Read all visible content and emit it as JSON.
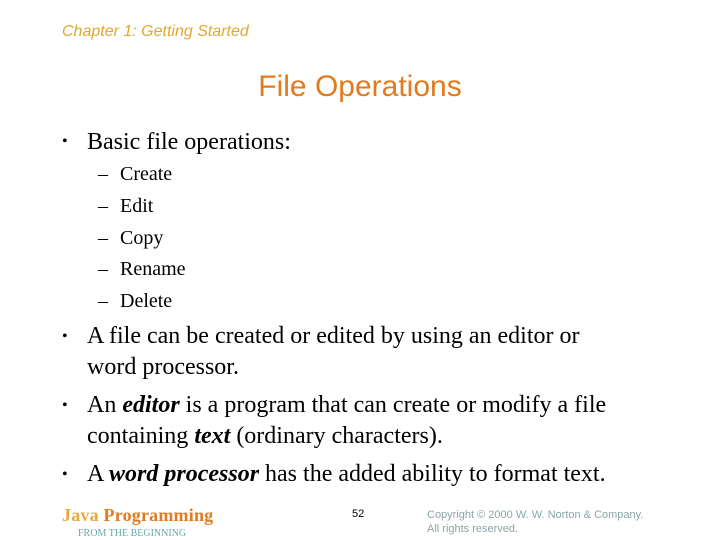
{
  "header": {
    "chapter": "Chapter 1: Getting Started"
  },
  "slide": {
    "title": "File Operations",
    "bullets": [
      {
        "text": "Basic file operations:",
        "sub_items": [
          "Create",
          "Edit",
          "Copy",
          "Rename",
          "Delete"
        ]
      }
    ],
    "paragraphs": [
      {
        "line1": "A file can be created or edited by using an editor or",
        "line2": "word processor."
      },
      {
        "pre": "An ",
        "em1": "editor",
        "mid1": " is a program that can create or modify a file",
        "line2_pre": "containing ",
        "em2": "text",
        "line2_post": " (ordinary characters)."
      },
      {
        "pre": "A ",
        "em1": "word processor",
        "post": " has the added ability to format text."
      }
    ],
    "bullet_glyph": "•",
    "dash_glyph": "–"
  },
  "footer": {
    "logo_word1": "Java",
    "logo_word2": "Programming",
    "logo_subtitle": "FROM THE BEGINNING",
    "page_number": "52",
    "copyright_line1": "Copyright © 2000 W. W. Norton & Company.",
    "copyright_line2": "All rights reserved."
  },
  "colors": {
    "chapter": "#e0a832",
    "title": "#e07b20",
    "logo_java": "#e8a83a",
    "logo_programming": "#e07b20",
    "logo_subtitle": "#6aa8a8",
    "copyright": "#8aa6a6"
  }
}
